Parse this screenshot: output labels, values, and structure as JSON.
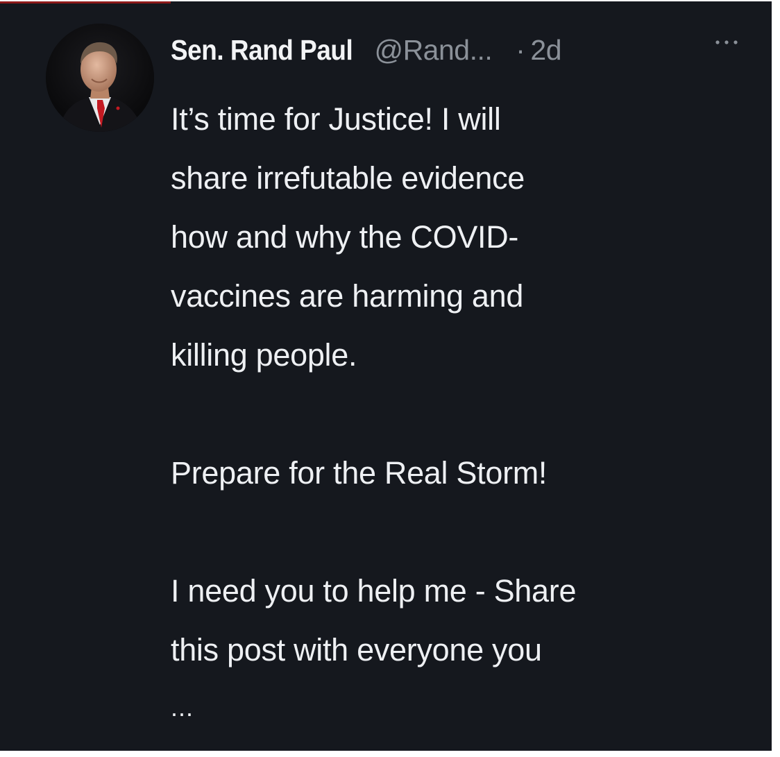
{
  "tweet": {
    "author": {
      "display_name": "Sen. Rand Paul",
      "handle": "@Rand...",
      "avatar_icon": "profile-photo"
    },
    "separator": "·",
    "time": "2d",
    "more_icon": "more-horizontal-icon",
    "paragraphs": [
      [
        "It’s time for Justice! I will",
        "share irrefutable evidence",
        "how and why the COVID-",
        "vaccines are harming and",
        "killing people."
      ],
      [
        "Prepare for the Real Storm!"
      ],
      [
        "I need you to help me - Share",
        "this post with everyone you"
      ]
    ],
    "truncation": "...",
    "colors": {
      "background": "#15181e",
      "text": "#eef0f3",
      "secondary_text": "#8b9199",
      "accent_bar": "#8e1a1a"
    }
  }
}
